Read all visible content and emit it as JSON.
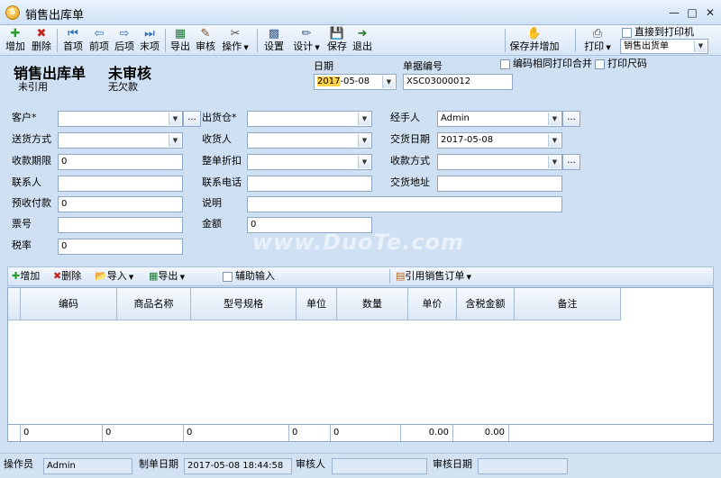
{
  "window": {
    "title": "销售出库单",
    "app_icon": "S"
  },
  "toolbar": {
    "add": "增加",
    "delete": "删除",
    "first": "首项",
    "prev": "前项",
    "next": "后项",
    "last": "末项",
    "export": "导出",
    "audit": "审核",
    "operate": "操作",
    "settings": "设置",
    "design": "设计",
    "save": "保存",
    "exit": "退出",
    "save_add": "保存并增加",
    "print": "打印",
    "direct_print": "直接到打印机",
    "print_template": "销售出货单"
  },
  "header": {
    "doc_title": "销售出库单",
    "audit_status": "未审核",
    "ref_status": "未引用",
    "debt_status": "无欠款",
    "date_label": "日期",
    "date_value": "2017-05-08",
    "date_year_highlight": "2017",
    "docno_label": "单据编号",
    "docno_value": "XSC03000012",
    "opt_merge_print": "编码相同打印合并",
    "opt_print_size": "打印尺码"
  },
  "form": {
    "customer": "客户*",
    "warehouse": "出货仓*",
    "handler": "经手人",
    "handler_value": "Admin",
    "ship_method": "送货方式",
    "receiver": "收货人",
    "delivery_date": "交货日期",
    "delivery_date_value": "2017-05-08",
    "collect_period": "收款期限",
    "collect_period_value": "0",
    "whole_discount": "整单折扣",
    "collect_method": "收款方式",
    "contact": "联系人",
    "contact_phone": "联系电话",
    "delivery_address": "交货地址",
    "prepaid": "预收付款",
    "prepaid_value": "0",
    "remark": "说明",
    "ticket_no": "票号",
    "amount": "金额",
    "amount_value": "0",
    "tax_rate": "税率",
    "tax_rate_value": "0"
  },
  "gridbar": {
    "add": "增加",
    "delete": "删除",
    "import": "导入",
    "export": "导出",
    "assist_input": "辅助输入",
    "ref_order": "引用销售订单"
  },
  "grid": {
    "columns": [
      "编码",
      "商品名称",
      "型号规格",
      "单位",
      "数量",
      "单价",
      "含税金额",
      "备注"
    ],
    "totals": [
      "0",
      "0",
      "0",
      "0",
      "0",
      "0.00",
      "0.00"
    ]
  },
  "statusbar": {
    "operator_label": "操作员",
    "operator_value": "Admin",
    "create_date_label": "制单日期",
    "create_date_value": "2017-05-08 18:44:58",
    "auditor_label": "审核人",
    "audit_date_label": "审核日期"
  },
  "watermark": "www.DuoTe.com",
  "colors": {
    "background": "#cfe0f3",
    "accent": "#2f6fb3"
  }
}
